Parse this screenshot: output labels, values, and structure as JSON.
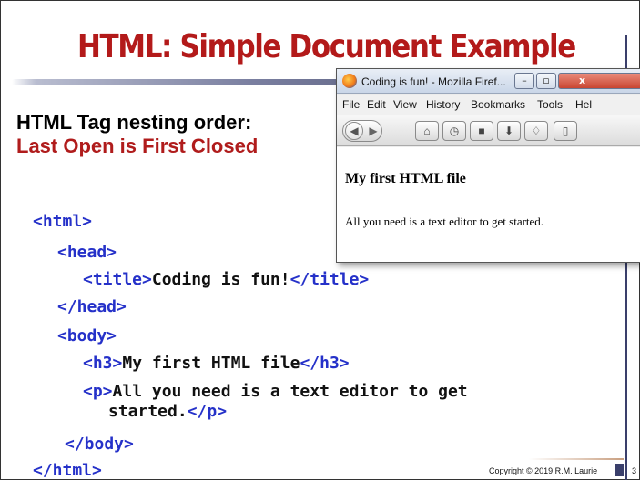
{
  "slide": {
    "title": "HTML: Simple Document Example",
    "nesting_heading": "HTML Tag nesting order:",
    "nesting_rule": "Last Open is First Closed",
    "code": {
      "line1": {
        "open": "<html>"
      },
      "line2": {
        "open": "<head>"
      },
      "line3": {
        "open": "<title>",
        "text": "Coding is fun!",
        "close": "</title>"
      },
      "line4": {
        "close": "</head>"
      },
      "line5": {
        "open": "<body>"
      },
      "line6": {
        "open": "<h3>",
        "text": "My first HTML file",
        "close": "</h3>"
      },
      "line7": {
        "open": "<p>",
        "text": "All you need is a text editor to get"
      },
      "line8": {
        "text": "started.",
        "close": "</p>"
      },
      "line9": {
        "close": "</body>"
      },
      "line10": {
        "close": "</html>"
      }
    },
    "copyright": "Copyright © 2019  R.M. Laurie",
    "page_number": "3"
  },
  "browser": {
    "window_title": "Coding is fun! - Mozilla Firef...",
    "window_buttons": {
      "minimize": "–",
      "maximize": "▫",
      "close": "x"
    },
    "menu": [
      "File",
      "Edit",
      "View",
      "History",
      "Bookmarks",
      "Tools",
      "Hel"
    ],
    "toolbar_icons": [
      "back-icon",
      "forward-icon",
      "home-icon",
      "history-icon",
      "bookmarks-icon",
      "download-icon",
      "addons-icon",
      "page-icon"
    ],
    "page": {
      "heading": "My first HTML file",
      "paragraph": "All you need is a text editor to get started."
    }
  },
  "colors": {
    "title": "#b31a1a",
    "rule_text": "#b01c1c",
    "tag": "#2531c9",
    "accent_bar": "#3a3f6b"
  }
}
